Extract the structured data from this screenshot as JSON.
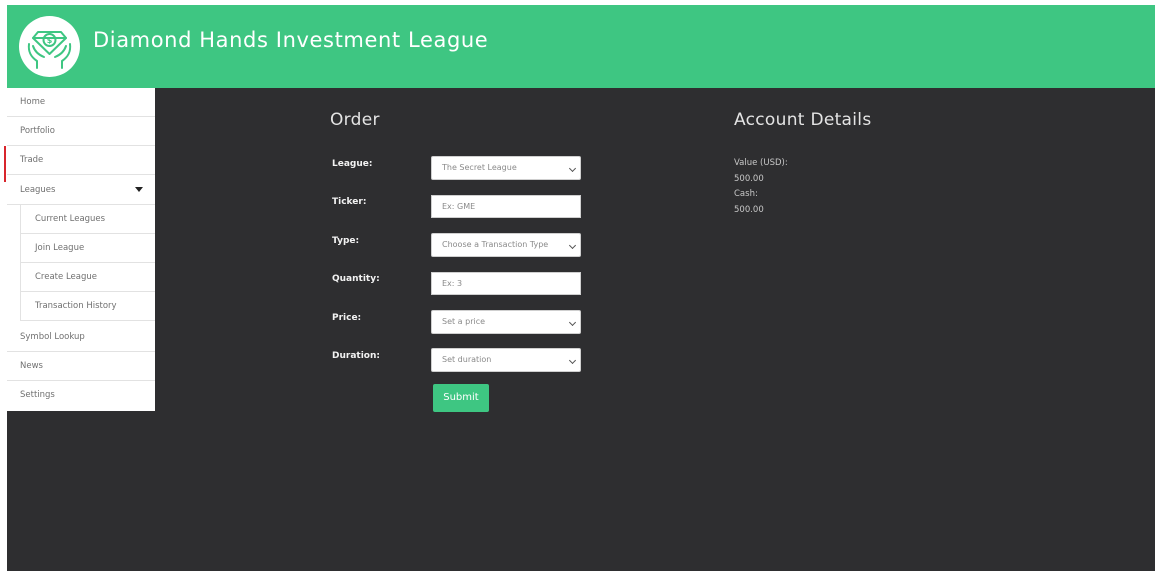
{
  "header": {
    "title": "Diamond Hands Investment League",
    "logo_icon": "diamond-hands-logo-icon"
  },
  "colors": {
    "brand_green": "#3ec682",
    "background_dark": "#2e2e30",
    "active_indicator": "#d8252c"
  },
  "sidebar": {
    "items": [
      {
        "label": "Home"
      },
      {
        "label": "Portfolio"
      },
      {
        "label": "Trade",
        "active": true
      },
      {
        "label": "Leagues",
        "expanded": true
      }
    ],
    "leagues_submenu": [
      {
        "label": "Current Leagues"
      },
      {
        "label": "Join League"
      },
      {
        "label": "Create League"
      },
      {
        "label": "Transaction History"
      }
    ],
    "bottom_items": [
      {
        "label": "Symbol Lookup"
      },
      {
        "label": "News"
      },
      {
        "label": "Settings"
      }
    ]
  },
  "order": {
    "title": "Order",
    "league": {
      "label": "League:",
      "value": "The Secret League"
    },
    "ticker": {
      "label": "Ticker:",
      "placeholder": "Ex: GME"
    },
    "type": {
      "label": "Type:",
      "value": "Choose a Transaction Type"
    },
    "quantity": {
      "label": "Quantity:",
      "placeholder": "Ex: 3"
    },
    "price": {
      "label": "Price:",
      "value": "Set a price"
    },
    "duration": {
      "label": "Duration:",
      "value": "Set duration"
    },
    "submit_label": "Submit"
  },
  "account": {
    "title": "Account Details",
    "value_label": "Value (USD):",
    "value_amount": "500.00",
    "cash_label": "Cash:",
    "cash_amount": "500.00"
  }
}
